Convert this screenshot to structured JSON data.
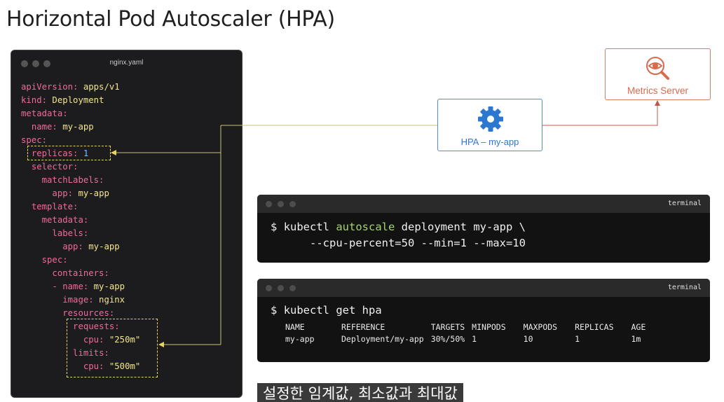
{
  "page": {
    "title": "Horizontal Pod Autoscaler (HPA)"
  },
  "editor": {
    "filename": "nginx.yaml",
    "lines": [
      {
        "key": "apiVersion:",
        "value": " apps/v1",
        "indent": ""
      },
      {
        "key": "kind:",
        "value": " Deployment",
        "indent": ""
      },
      {
        "key": "metadata:",
        "value": "",
        "indent": ""
      },
      {
        "key": "name:",
        "value": " my-app",
        "indent": "  "
      },
      {
        "key": "spec:",
        "value": "",
        "indent": ""
      },
      {
        "key": "replicas:",
        "value": " 1",
        "indent": "  ",
        "numeric": true
      },
      {
        "key": "selector:",
        "value": "",
        "indent": "  "
      },
      {
        "key": "matchLabels:",
        "value": "",
        "indent": "    "
      },
      {
        "key": "app:",
        "value": " my-app",
        "indent": "      "
      },
      {
        "key": "template:",
        "value": "",
        "indent": "  "
      },
      {
        "key": "metadata:",
        "value": "",
        "indent": "    "
      },
      {
        "key": "labels:",
        "value": "",
        "indent": "      "
      },
      {
        "key": "app:",
        "value": " my-app",
        "indent": "        "
      },
      {
        "key": "spec:",
        "value": "",
        "indent": "    "
      },
      {
        "key": "containers:",
        "value": "",
        "indent": "      "
      },
      {
        "key": "- name:",
        "value": " my-app",
        "indent": "      "
      },
      {
        "key": "image:",
        "value": " nginx",
        "indent": "        "
      },
      {
        "key": "resources:",
        "value": "",
        "indent": "        "
      },
      {
        "key": "requests:",
        "value": "",
        "indent": "          "
      },
      {
        "key": "cpu:",
        "value": " \"250m\"",
        "indent": "            "
      },
      {
        "key": "limits:",
        "value": "",
        "indent": "          "
      },
      {
        "key": "cpu:",
        "value": " \"500m\"",
        "indent": "            "
      }
    ]
  },
  "hpa": {
    "label": "HPA – my-app",
    "icon": "gear-icon",
    "color": "#2c78d0"
  },
  "metrics": {
    "label": "Metrics Server",
    "icon": "magnifier-eye-icon",
    "color": "#d86a4e"
  },
  "terminal1": {
    "title": "terminal",
    "prompt": "$",
    "cmd_start": "kubectl ",
    "cmd_highlight": "autoscale",
    "cmd_end": " deployment my-app \\",
    "line2": "      --cpu-percent=50 --min=1 --max=10"
  },
  "terminal2": {
    "title": "terminal",
    "prompt": "$",
    "command": "kubectl get hpa",
    "headers": [
      "NAME",
      "REFERENCE",
      "TARGETS",
      "MINPODS",
      "MAXPODS",
      "REPLICAS",
      "AGE"
    ],
    "rows": [
      [
        "my-app",
        "Deployment/my-app",
        "30%/50%",
        "1",
        "10",
        "1",
        "1m"
      ]
    ]
  },
  "subtitle": "설정한 임계값, 최소값과 최대값"
}
